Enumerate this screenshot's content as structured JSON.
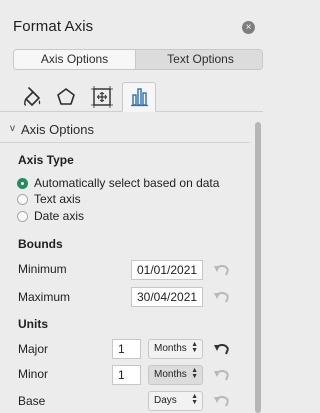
{
  "pane": {
    "title": "Format Axis",
    "close_label": "×"
  },
  "segmented": {
    "axis_options": "Axis Options",
    "text_options": "Text Options",
    "active": "Text Options"
  },
  "icon_tabs": [
    {
      "name": "fill-line",
      "icon": "paint-bucket-icon",
      "selected": false
    },
    {
      "name": "effects",
      "icon": "pentagon-icon",
      "selected": false
    },
    {
      "name": "size-properties",
      "icon": "size-properties-icon",
      "selected": false
    },
    {
      "name": "axis-options",
      "icon": "bar-chart-icon",
      "selected": true
    }
  ],
  "section": {
    "title": "Axis Options",
    "chevron": "v"
  },
  "axis_type": {
    "heading": "Axis Type",
    "options": [
      {
        "label": "Automatically select based on data",
        "checked": true
      },
      {
        "label": "Text axis",
        "checked": false
      },
      {
        "label": "Date axis",
        "checked": false
      }
    ]
  },
  "bounds": {
    "heading": "Bounds",
    "minimum_label": "Minimum",
    "minimum_value": "01/01/2021",
    "maximum_label": "Maximum",
    "maximum_value": "30/04/2021"
  },
  "units": {
    "heading": "Units",
    "major_label": "Major",
    "major_value": "1",
    "major_unit": "Months",
    "minor_label": "Minor",
    "minor_value": "1",
    "minor_unit": "Months",
    "base_label": "Base",
    "base_unit": "Days"
  },
  "colors": {
    "accent": "#2a8b5f",
    "panel_bg": "#ececec",
    "reset_active": "#333333",
    "reset_inactive": "#b8b8b8"
  }
}
